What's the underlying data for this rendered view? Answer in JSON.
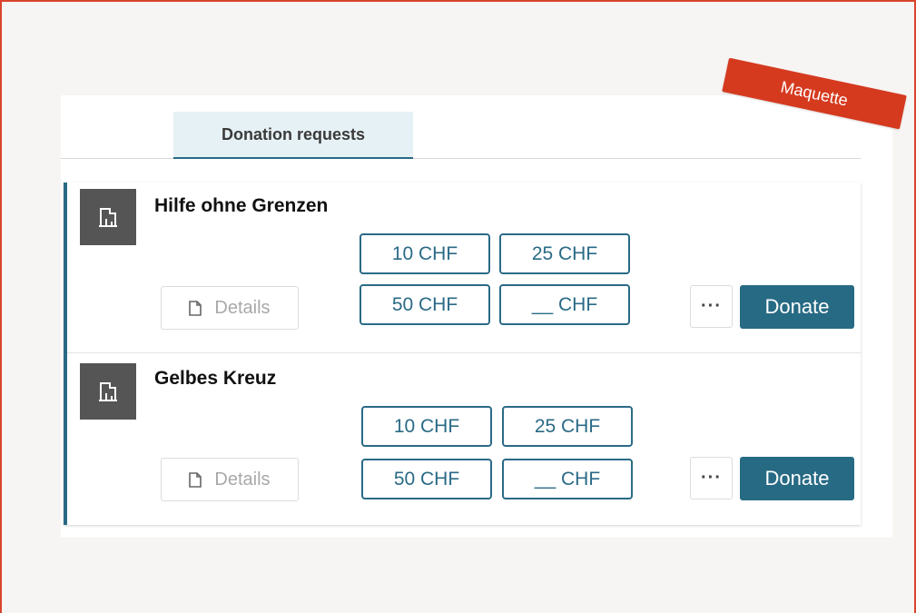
{
  "tabs": [
    {
      "label": "Donation requests",
      "active": true
    }
  ],
  "stamp": {
    "label": "Maquette"
  },
  "organizations": [
    {
      "name": "Hilfe ohne Grenzen",
      "details_label": "Details",
      "amounts": [
        "10 CHF",
        "25 CHF",
        "50 CHF",
        "__ CHF"
      ],
      "more_label": "···",
      "donate_label": "Donate",
      "icon": "building-icon"
    },
    {
      "name": "Gelbes Kreuz",
      "details_label": "Details",
      "amounts": [
        "10 CHF",
        "25 CHF",
        "50 CHF",
        "__ CHF"
      ],
      "more_label": "···",
      "donate_label": "Donate",
      "icon": "building-icon"
    }
  ],
  "colors": {
    "accent": "#2a6a86",
    "frame_border": "#d9432c",
    "stamp": "#d53a1f",
    "icon_bg": "#555555"
  }
}
